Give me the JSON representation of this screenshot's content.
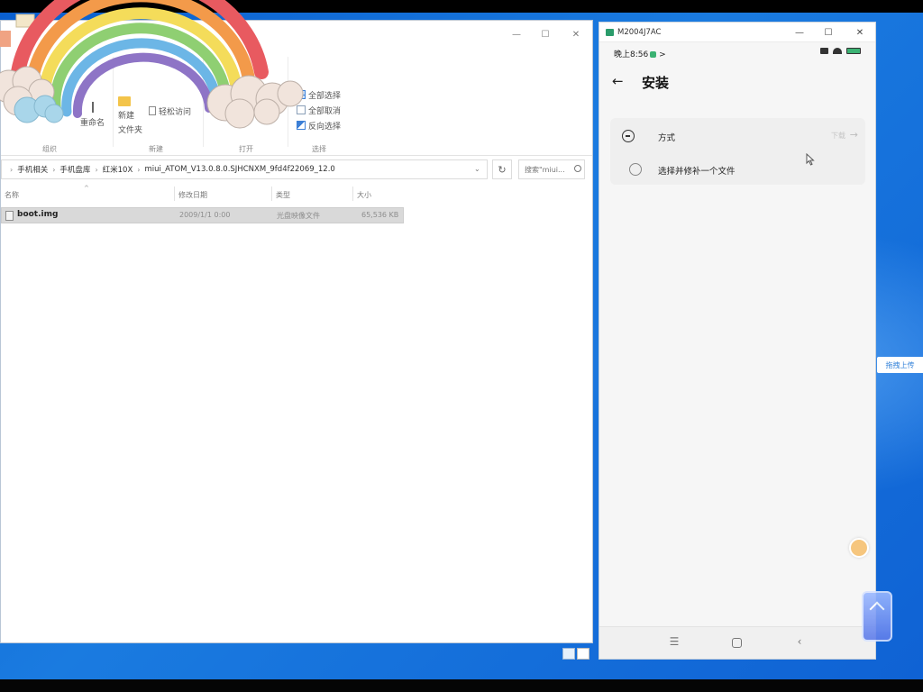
{
  "explorer": {
    "window_controls": {
      "minimize": "—",
      "maximize": "☐",
      "close": "✕"
    },
    "help": "?",
    "ribbon": {
      "select_all": "全部选择",
      "select_none": "全部取消",
      "invert_selection": "反向选择",
      "rename": "重命名",
      "new_folder_line1": "新建",
      "new_folder_line2": "文件夹",
      "easy_access": "轻松访问",
      "group_organize": "组织",
      "group_new": "新建",
      "group_open": "打开",
      "group_select": "选择"
    },
    "breadcrumbs": [
      "手机相关",
      "手机盘库",
      "红米10X",
      "miui_ATOM_V13.0.8.0.SJHCNXM_9fd4f22069_12.0"
    ],
    "breadcrumb_sep": "›",
    "search_placeholder": "搜索\"miui...",
    "columns": {
      "name": "名称",
      "date": "修改日期",
      "type": "类型",
      "size": "大小"
    },
    "files": [
      {
        "name": "boot.img",
        "date": "2009/1/1 0:00",
        "type": "光盘映像文件",
        "size": "65,536 KB"
      }
    ]
  },
  "phone": {
    "window_title": "M2004J7AC",
    "window_controls": {
      "minimize": "—",
      "maximize": "☐",
      "close": "✕"
    },
    "status_time": "晚上8:56",
    "status_more": ">",
    "back": "←",
    "heading": "安装",
    "options": [
      {
        "label": "方式",
        "action": "下载"
      },
      {
        "label": "选择并修补一个文件"
      }
    ],
    "option_arrow": "→",
    "nav": {
      "menu": "☰",
      "back": "‹"
    }
  },
  "side_tag": "拖拽上传",
  "colors": {
    "desktop_blue": "#1a7be0",
    "accent": "#1a73d9",
    "status_green": "#3bb273"
  }
}
